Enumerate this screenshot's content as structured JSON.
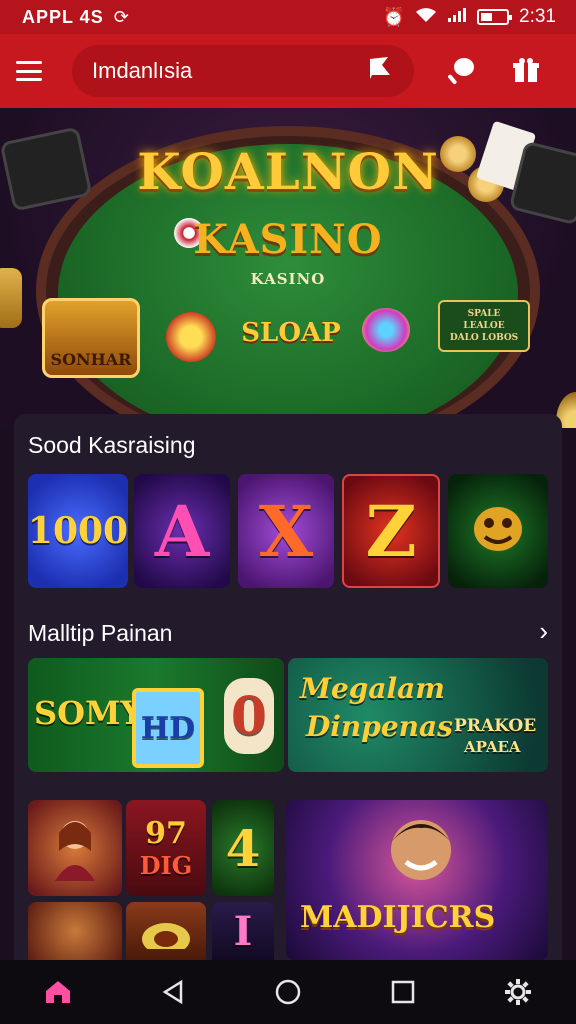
{
  "status_bar": {
    "carrier": "APPL 4S",
    "time": "2:31"
  },
  "app_bar": {
    "search_text": "Imdanlısia"
  },
  "hero": {
    "title": "KOALNON",
    "subtitle": "KASINO",
    "caption": "KASINO",
    "left_badge": "SONHAR",
    "center_badge": "SLOAP",
    "right_badge_line1": "SPALE",
    "right_badge_line2": "LEALOE",
    "right_badge_line3": "DALO LOBOS"
  },
  "section1": {
    "title": "Sood Kasraising",
    "tiles": [
      {
        "label": "1000",
        "bg": "#1f3fd6"
      },
      {
        "label": "A",
        "bg": "#3a1470"
      },
      {
        "label": "X",
        "bg": "#6a1e9a"
      },
      {
        "label": "Z",
        "bg": "#a2121e"
      },
      {
        "label": "",
        "bg": "#0e3a14"
      }
    ]
  },
  "section2": {
    "title": "Malltip Painan",
    "more": "›",
    "tile_left": {
      "label1": "SOMY",
      "label2": "HD",
      "label3": "0"
    },
    "tile_right": {
      "label1": "Megalam",
      "label2": "Dinpenas",
      "label3": "PRAKOE",
      "label4": "APAEA"
    }
  },
  "section3": {
    "tile_a": {
      "label": ""
    },
    "tile_b": {
      "label1": "97",
      "label2": "DIG"
    },
    "tile_c": {
      "label": "4"
    },
    "tile_d": {
      "label": "MADIJICRS"
    },
    "tile_e": {
      "label": "I"
    }
  },
  "colors": {
    "brand_red": "#c8181f",
    "status_red": "#b5141c",
    "panel": "#231a2c",
    "gold": "#ffcb3a",
    "home_active": "#ff4fa0"
  }
}
